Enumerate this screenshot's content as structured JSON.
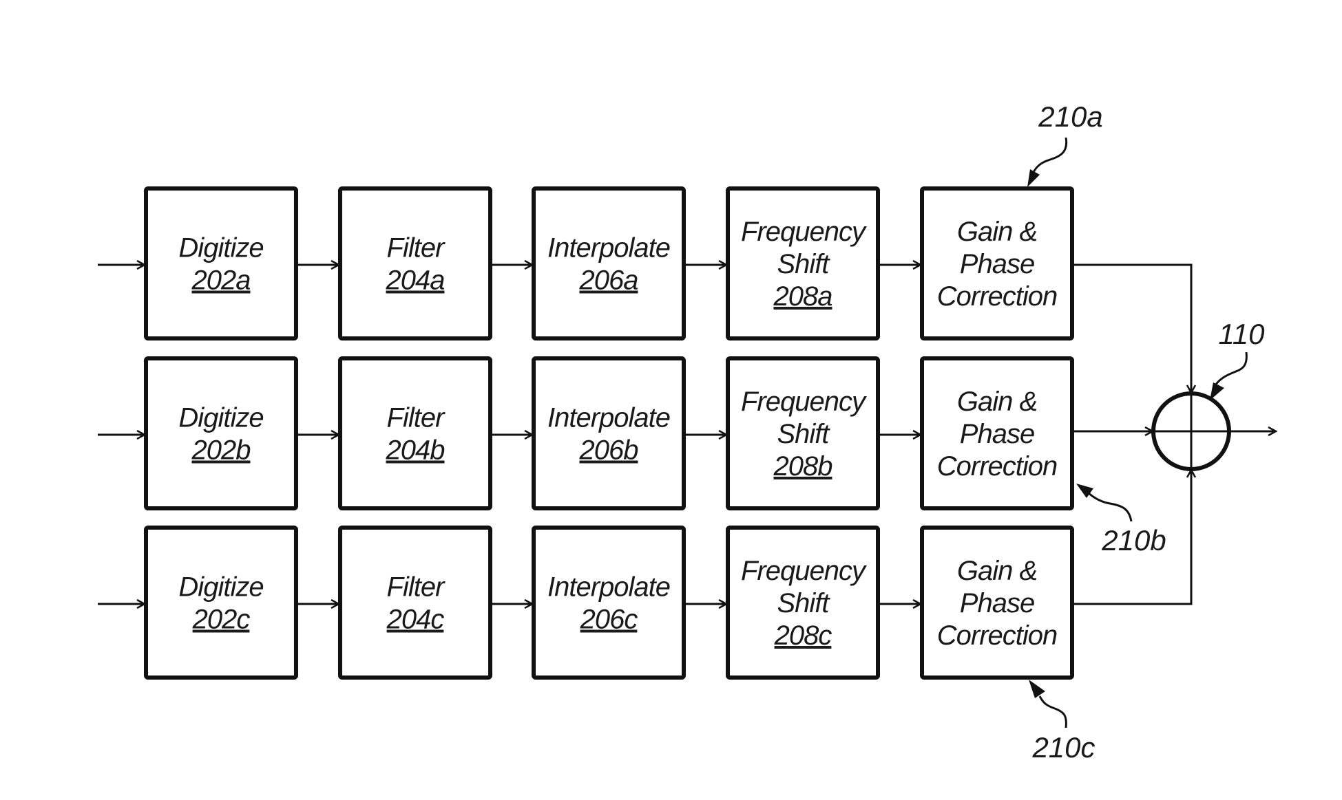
{
  "figure": {
    "rows": [
      {
        "id": "a",
        "blocks": [
          {
            "lines": [
              "Digitize"
            ],
            "ref": "202a"
          },
          {
            "lines": [
              "Filter"
            ],
            "ref": "204a"
          },
          {
            "lines": [
              "Interpolate"
            ],
            "ref": "206a"
          },
          {
            "lines": [
              "Frequency",
              "Shift"
            ],
            "ref": "208a"
          },
          {
            "lines": [
              "Gain &",
              "Phase",
              "Correction"
            ],
            "ref": ""
          }
        ]
      },
      {
        "id": "b",
        "blocks": [
          {
            "lines": [
              "Digitize"
            ],
            "ref": "202b"
          },
          {
            "lines": [
              "Filter"
            ],
            "ref": "204b"
          },
          {
            "lines": [
              "Interpolate"
            ],
            "ref": "206b"
          },
          {
            "lines": [
              "Frequency",
              "Shift"
            ],
            "ref": "208b"
          },
          {
            "lines": [
              "Gain &",
              "Phase",
              "Correction"
            ],
            "ref": ""
          }
        ]
      },
      {
        "id": "c",
        "blocks": [
          {
            "lines": [
              "Digitize"
            ],
            "ref": "202c"
          },
          {
            "lines": [
              "Filter"
            ],
            "ref": "204c"
          },
          {
            "lines": [
              "Interpolate"
            ],
            "ref": "206c"
          },
          {
            "lines": [
              "Frequency",
              "Shift"
            ],
            "ref": "208c"
          },
          {
            "lines": [
              "Gain &",
              "Phase",
              "Correction"
            ],
            "ref": ""
          }
        ]
      }
    ],
    "callouts": {
      "gain_a": "210a",
      "gain_b": "210b",
      "gain_c": "210c",
      "summer": "110"
    }
  }
}
